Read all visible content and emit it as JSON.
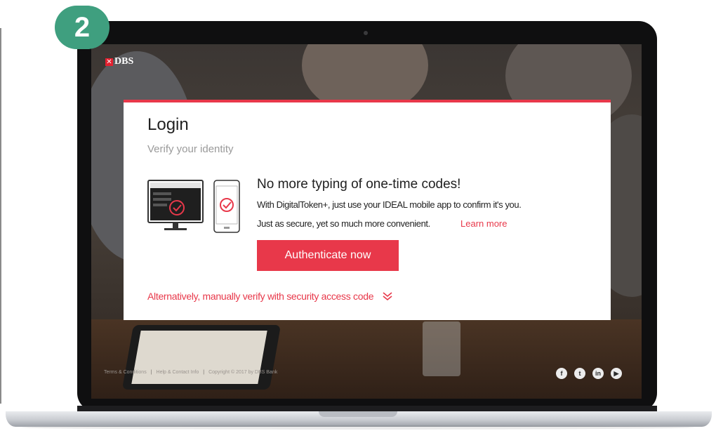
{
  "step_badge": "2",
  "brand": {
    "mark": "✕",
    "name": "DBS"
  },
  "login": {
    "title": "Login",
    "subtitle": "Verify your identity",
    "promo_heading": "No more typing of one-time codes!",
    "promo_line1": "With DigitalToken+, just use your IDEAL mobile app to confirm it's you.",
    "promo_line2": "Just as secure, yet so much more convenient.",
    "learn_more": "Learn more",
    "authenticate_button": "Authenticate now",
    "alternative_link": "Alternatively, manually verify with security access code"
  },
  "footer": {
    "terms": "Terms & Conditions",
    "help": "Help & Contact Info",
    "copyright": "Copyright © 2017 by DBS Bank"
  },
  "social": [
    {
      "name": "facebook-icon",
      "glyph": "f"
    },
    {
      "name": "twitter-icon",
      "glyph": "t"
    },
    {
      "name": "linkedin-icon",
      "glyph": "in"
    },
    {
      "name": "youtube-icon",
      "glyph": "▶"
    }
  ],
  "colors": {
    "accent": "#e8384a",
    "badge": "#3f9f7f"
  }
}
